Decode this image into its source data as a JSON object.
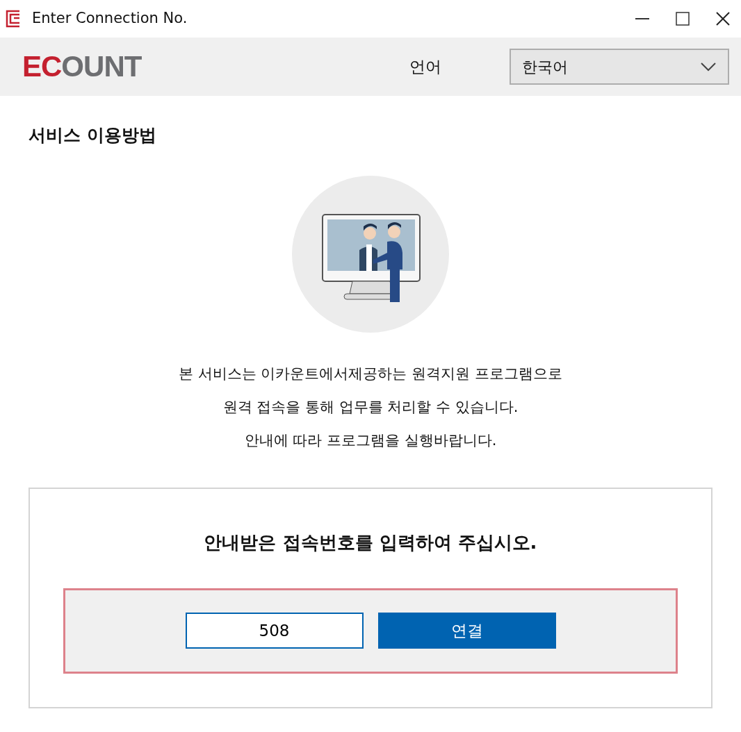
{
  "window": {
    "title": "Enter Connection No."
  },
  "header": {
    "logo": "ECOUNT",
    "language_label": "언어",
    "language_select": {
      "value": "한국어"
    }
  },
  "section_title": "서비스 이용방법",
  "description": [
    "본 서비스는 이카운트에서제공하는 원격지원 프로그램으로",
    "원격 접속을 통해 업무를 처리할 수 있습니다.",
    "안내에 따라 프로그램을 실행바랍니다."
  ],
  "connect_panel": {
    "prompt": "안내받은 접속번호를 입력하여 주십시오.",
    "connection_number": "508",
    "connect_button": "연결"
  }
}
